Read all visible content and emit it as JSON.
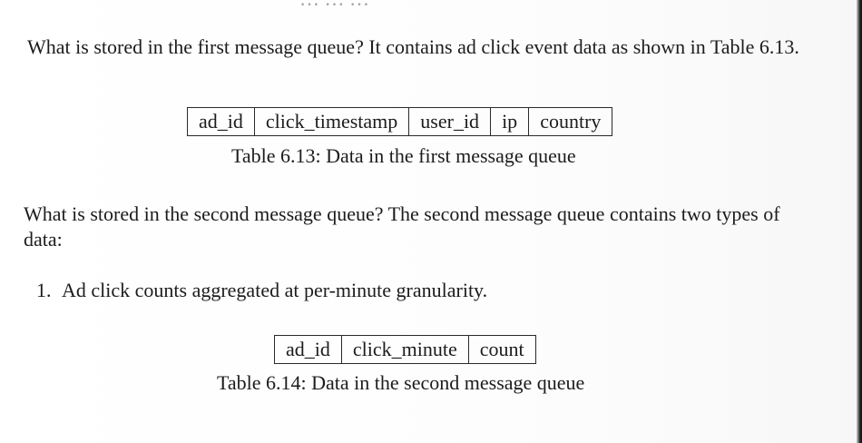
{
  "top_fragment": "… … …",
  "paragraph_1": "What is stored in the first message queue? It contains ad click event data as shown in Table 6.13.",
  "table_1": {
    "columns": [
      "ad_id",
      "click_timestamp",
      "user_id",
      "ip",
      "country"
    ]
  },
  "caption_1": "Table 6.13: Data in the first message queue",
  "paragraph_2": "What is stored in the second message queue? The second message queue contains two types of data:",
  "list": [
    {
      "number": "1.",
      "text": "Ad click counts aggregated at per-minute granularity."
    }
  ],
  "table_2": {
    "columns": [
      "ad_id",
      "click_minute",
      "count"
    ]
  },
  "caption_2": "Table 6.14: Data in the second message queue"
}
